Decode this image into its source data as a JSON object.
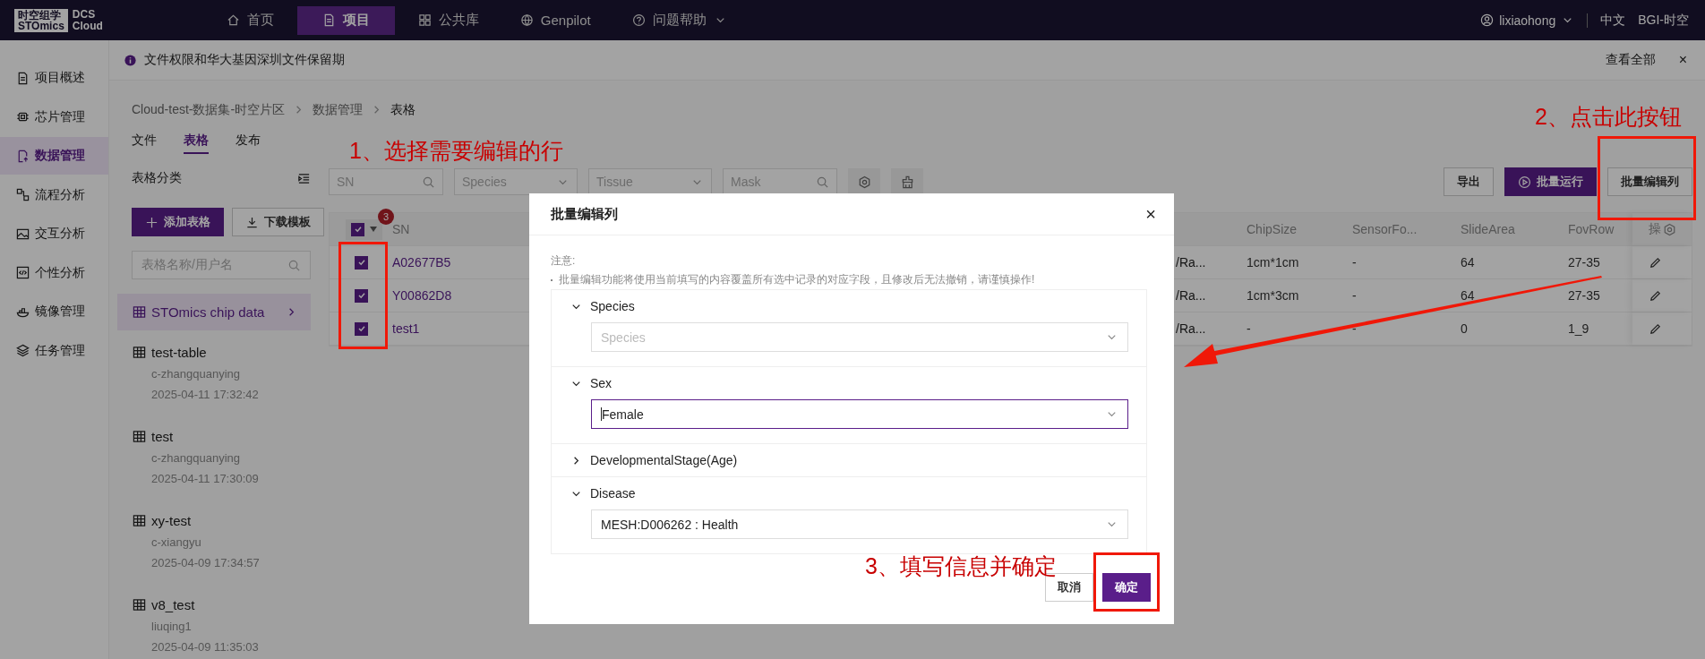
{
  "topbar": {
    "logo_cn": "时空组学",
    "logo_en": "STOmics",
    "product": [
      "DCS",
      "Cloud"
    ],
    "nav": [
      {
        "label": "首页",
        "selected": false,
        "caret": false
      },
      {
        "label": "项目",
        "selected": true,
        "caret": false
      },
      {
        "label": "公共库",
        "selected": false,
        "caret": false
      },
      {
        "label": "Genpilot",
        "selected": false,
        "caret": false
      },
      {
        "label": "问题帮助",
        "selected": false,
        "caret": true
      }
    ],
    "user": "lixiaohong",
    "language": "中文",
    "org": "BGI-时空"
  },
  "notice": {
    "text": "文件权限和华大基因深圳文件保留期",
    "link": "查看全部",
    "close": "×"
  },
  "left_nav": [
    {
      "label": "项目概述",
      "selected": false
    },
    {
      "label": "芯片管理",
      "selected": false
    },
    {
      "label": "数据管理",
      "selected": true
    },
    {
      "label": "流程分析",
      "selected": false
    },
    {
      "label": "交互分析",
      "selected": false
    },
    {
      "label": "个性分析",
      "selected": false
    },
    {
      "label": "镜像管理",
      "selected": false
    },
    {
      "label": "任务管理",
      "selected": false
    }
  ],
  "breadcrumb": [
    "Cloud-test-数据集-时空片区",
    "数据管理",
    "表格"
  ],
  "tabs": [
    {
      "label": "文件",
      "selected": false
    },
    {
      "label": "表格",
      "selected": true
    },
    {
      "label": "发布",
      "selected": false
    }
  ],
  "sidebar": {
    "title": "表格分类",
    "add_button": "添加表格",
    "download_button": "下载模板",
    "search": {
      "placeholder": "表格名称/用户名"
    },
    "items": [
      {
        "name": "STOmics chip data",
        "selected": true
      },
      {
        "name": "test-table",
        "user": "c-zhangquanying",
        "time": "2025-04-11 17:32:42",
        "selected": false
      },
      {
        "name": "test",
        "user": "c-zhangquanying",
        "time": "2025-04-11 17:30:09",
        "selected": false
      },
      {
        "name": "xy-test",
        "user": "c-xiangyu",
        "time": "2025-04-09 17:34:57",
        "selected": false
      },
      {
        "name": "v8_test",
        "user": "liuqing1",
        "time": "2025-04-09 11:35:03",
        "selected": false
      }
    ]
  },
  "filters": [
    {
      "kind": "search",
      "placeholder": "SN"
    },
    {
      "kind": "select",
      "placeholder": "Species"
    },
    {
      "kind": "select",
      "placeholder": "Tissue"
    },
    {
      "kind": "search",
      "placeholder": "Mask"
    }
  ],
  "actions": [
    {
      "label": "导出",
      "primary": false,
      "icon": false
    },
    {
      "label": "批量运行",
      "primary": true,
      "icon": true
    },
    {
      "label": "批量编辑列",
      "primary": false,
      "icon": false
    }
  ],
  "table": {
    "all_checked": true,
    "selected_count": "3",
    "columns": [
      "SN",
      "ChipSize",
      "SensorFo...",
      "SlideArea",
      "FovRow",
      "操"
    ],
    "rows": [
      {
        "checked": true,
        "sn": "A02677B5",
        "cells": [
          "/Ra...",
          "1cm*1cm",
          "-",
          "64",
          "27-35"
        ]
      },
      {
        "checked": true,
        "sn": "Y00862D8",
        "cells": [
          "/Ra...",
          "1cm*3cm",
          "-",
          "64",
          "27-35"
        ]
      },
      {
        "checked": true,
        "sn": "test1",
        "cells": [
          "/Ra...",
          "-",
          "-",
          "0",
          "1_9"
        ]
      }
    ]
  },
  "modal": {
    "title": "批量编辑列",
    "close": "×",
    "note_title": "注意:",
    "note": "批量编辑功能将使用当前填写的内容覆盖所有选中记录的对应字段，且修改后无法撤销，请谨慎操作!",
    "sections": [
      {
        "label": "Species",
        "expanded": true,
        "placeholder": "Species",
        "focused": false
      },
      {
        "label": "Sex",
        "expanded": true,
        "value": "Female",
        "focused": true
      },
      {
        "label": "DevelopmentalStage(Age)",
        "expanded": false
      },
      {
        "label": "Disease",
        "expanded": true,
        "value": "MESH:D006262 : Health",
        "focused": false
      }
    ],
    "cancel": "取消",
    "confirm": "确定"
  },
  "annotations": [
    "1、选择需要编辑的行",
    "2、点击此按钮",
    "3、填写信息并确定"
  ]
}
